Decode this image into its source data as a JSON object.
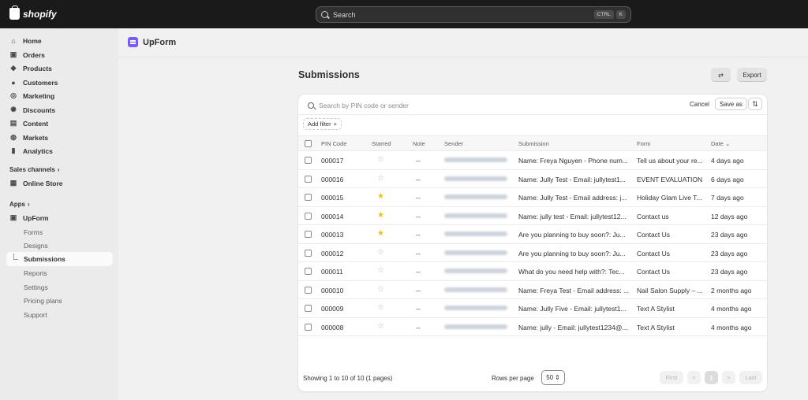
{
  "topbar": {
    "logo_text": "shopify",
    "search_placeholder": "Search",
    "shortcut_keys": [
      "CTRL",
      "K"
    ]
  },
  "sidebar": {
    "main_items": [
      {
        "label": "Home",
        "icon": "home-icon"
      },
      {
        "label": "Orders",
        "icon": "inbox-icon"
      },
      {
        "label": "Products",
        "icon": "tag-icon"
      },
      {
        "label": "Customers",
        "icon": "person-icon"
      },
      {
        "label": "Marketing",
        "icon": "target-icon"
      },
      {
        "label": "Discounts",
        "icon": "discount-icon"
      },
      {
        "label": "Content",
        "icon": "content-icon"
      },
      {
        "label": "Markets",
        "icon": "globe-icon"
      },
      {
        "label": "Analytics",
        "icon": "bar-chart-icon"
      }
    ],
    "sales_channels_label": "Sales channels",
    "online_store_label": "Online Store",
    "apps_label": "Apps",
    "app_label": "UpForm",
    "app_sub_items": [
      "Forms",
      "Designs",
      "Submissions",
      "Reports",
      "Settings",
      "Pricing plans",
      "Support"
    ],
    "active_sub_item": "Submissions"
  },
  "app": {
    "name": "UpForm"
  },
  "page": {
    "title": "Submissions",
    "export_label": "Export"
  },
  "card": {
    "search_placeholder": "Search by PIN code or sender",
    "cancel_label": "Cancel",
    "save_as_label": "Save as",
    "add_filter_label": "Add filter",
    "add_filter_plus": "+",
    "columns": [
      "PIN Code",
      "Starred",
      "Note",
      "Sender",
      "Submission",
      "Form",
      "Date"
    ],
    "rows": [
      {
        "pin": "000017",
        "starred": false,
        "note": "--",
        "submission": "Name: Freya Nguyen - Phone num...",
        "form": "Tell us about your re...",
        "date": "4 days ago"
      },
      {
        "pin": "000016",
        "starred": false,
        "note": "--",
        "submission": "Name: Jully Test - Email: jullytest1...",
        "form": "EVENT EVALUATION",
        "date": "6 days ago"
      },
      {
        "pin": "000015",
        "starred": true,
        "note": "--",
        "submission": "Name: Jully Test - Email address: j...",
        "form": "Holiday Glam Live T...",
        "date": "7 days ago"
      },
      {
        "pin": "000014",
        "starred": true,
        "note": "--",
        "submission": "Name: jully test - Email: jullytest12...",
        "form": "Contact us",
        "date": "12 days ago"
      },
      {
        "pin": "000013",
        "starred": true,
        "note": "--",
        "submission": "Are you planning to buy soon?: Ju...",
        "form": "Contact Us",
        "date": "23 days ago"
      },
      {
        "pin": "000012",
        "starred": false,
        "note": "--",
        "submission": "Are you planning to buy soon?: Ju...",
        "form": "Contact Us",
        "date": "23 days ago"
      },
      {
        "pin": "000011",
        "starred": false,
        "note": "--",
        "submission": "What do you need help with?: Tec...",
        "form": "Contact Us",
        "date": "23 days ago"
      },
      {
        "pin": "000010",
        "starred": false,
        "note": "--",
        "submission": "Name: Freya Test - Email address: ...",
        "form": "Nail Salon Supply – ...",
        "date": "2 months ago"
      },
      {
        "pin": "000009",
        "starred": false,
        "note": "--",
        "submission": "Name: Jully Five - Email: jullytest1...",
        "form": "Text A Stylist",
        "date": "4 months ago"
      },
      {
        "pin": "000008",
        "starred": false,
        "note": "--",
        "submission": "Name: jully - Email: jullytest1234@...",
        "form": "Text A Stylist",
        "date": "4 months ago"
      }
    ],
    "showing_text": "Showing 1 to 10 of 10 (1 pages)",
    "rows_per_page_label": "Rows per page",
    "rows_per_page_value": "50",
    "pagination": {
      "first": "First",
      "prev": "<",
      "current": "1",
      "next": ">",
      "last": "Last"
    }
  },
  "colors": {
    "topbar": "#1a1a1a",
    "star_active": "#f0c019",
    "app_logo": "#7b5cf0"
  }
}
